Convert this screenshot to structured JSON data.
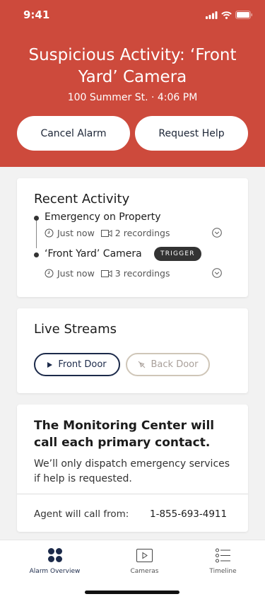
{
  "status_bar": {
    "time": "9:41"
  },
  "alert": {
    "title": "Suspicious Activity: ‘Front Yard’ Camera",
    "subtitle": "100 Summer St. · 4:06 PM",
    "cancel_label": "Cancel Alarm",
    "help_label": "Request Help"
  },
  "recent_activity": {
    "title": "Recent Activity",
    "items": [
      {
        "label": "Emergency on Property",
        "time": "Just now",
        "recordings": "2 recordings"
      },
      {
        "label": "‘Front Yard’ Camera",
        "badge": "TRIGGER",
        "time": "Just now",
        "recordings": "3 recordings"
      }
    ]
  },
  "live_streams": {
    "title": "Live Streams",
    "front_label": "Front Door",
    "back_label": "Back Door"
  },
  "monitoring": {
    "title": "The Monitoring Center will call each primary contact.",
    "body": "We’ll only dispatch emergency services if help is requested.",
    "agent_label": "Agent will call from:",
    "agent_phone": "1-855-693-4911"
  },
  "tabbar": {
    "tabs": [
      {
        "label": "Alarm Overview",
        "icon": "dots-grid-icon",
        "active": true
      },
      {
        "label": "Cameras",
        "icon": "play-box-icon",
        "active": false
      },
      {
        "label": "Timeline",
        "icon": "list-icon",
        "active": false
      }
    ]
  },
  "colors": {
    "accent": "#cd4a3c",
    "navy": "#1c2a4a"
  }
}
